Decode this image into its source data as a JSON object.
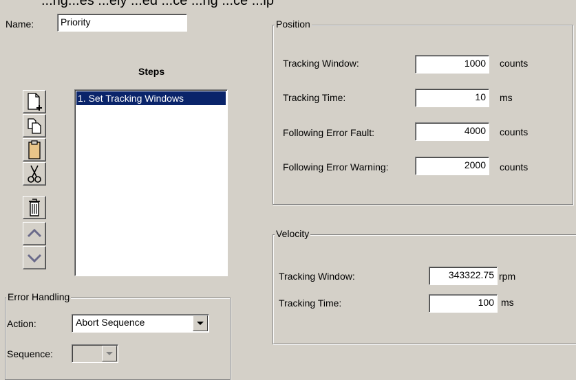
{
  "top_partial_text": "...ng...es ...ely ...ed ...ce ...ng ...ce ...ip",
  "name": {
    "label": "Name:",
    "value": "Priority"
  },
  "steps": {
    "title": "Steps",
    "items": [
      "1. Set Tracking Windows"
    ],
    "toolbar_icons": [
      "new-step-icon",
      "copy-icon",
      "paste-icon",
      "cut-icon",
      "delete-icon",
      "move-up-icon",
      "move-down-icon"
    ]
  },
  "error_handling": {
    "title": "Error Handling",
    "action_label": "Action:",
    "action_value": "Abort Sequence",
    "sequence_label": "Sequence:",
    "sequence_value": ""
  },
  "position": {
    "title": "Position",
    "rows": [
      {
        "label": "Tracking Window:",
        "value": "1000",
        "unit": "counts"
      },
      {
        "label": "Tracking Time:",
        "value": "10",
        "unit": "ms"
      },
      {
        "label": "Following Error Fault:",
        "value": "4000",
        "unit": "counts"
      },
      {
        "label": "Following Error Warning:",
        "value": "2000",
        "unit": "counts"
      }
    ]
  },
  "velocity": {
    "title": "Velocity",
    "rows": [
      {
        "label": "Tracking Window:",
        "value": "343322.75",
        "unit": "rpm"
      },
      {
        "label": "Tracking Time:",
        "value": "100",
        "unit": "ms"
      }
    ]
  }
}
